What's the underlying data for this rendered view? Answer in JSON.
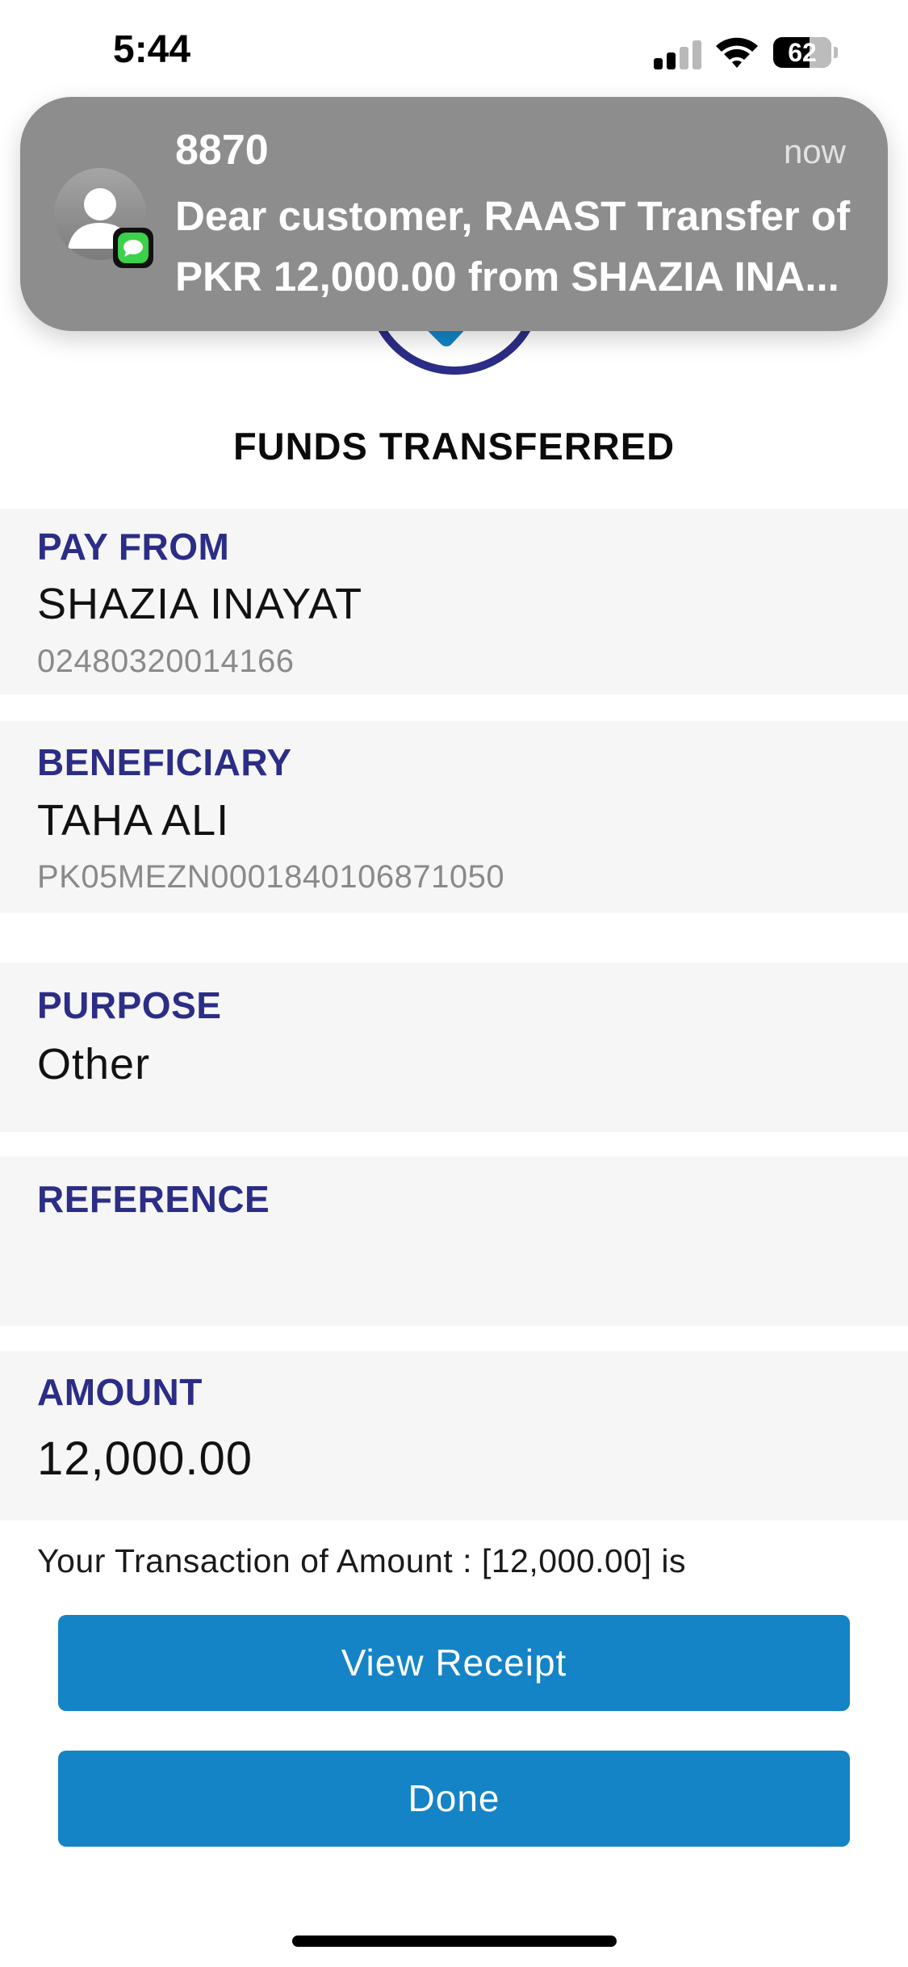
{
  "status_bar": {
    "time": "5:44",
    "battery_level": "62",
    "signal_bars_filled": 2,
    "signal_bars_total": 4
  },
  "notification": {
    "sender": "8870",
    "time": "now",
    "body_line1": "Dear customer, RAAST Transfer of",
    "body_line2": "PKR 12,000.00 from SHAZIA  INA..."
  },
  "page": {
    "title": "FUNDS TRANSFERRED",
    "accent_color": "#2b2d86",
    "button_color": "#1584c6"
  },
  "pay_from": {
    "label": "PAY FROM",
    "name": "SHAZIA  INAYAT",
    "account": "02480320014166"
  },
  "beneficiary": {
    "label": "BENEFICIARY",
    "name": "TAHA ALI",
    "account": "PK05MEZN0001840106871050"
  },
  "purpose": {
    "label": "PURPOSE",
    "value": "Other"
  },
  "reference": {
    "label": "REFERENCE",
    "value": ""
  },
  "amount": {
    "label": "AMOUNT",
    "value": "12,000.00"
  },
  "transaction_message": "Your Transaction of Amount : [12,000.00] is",
  "buttons": {
    "view_receipt": "View Receipt",
    "done": "Done"
  }
}
